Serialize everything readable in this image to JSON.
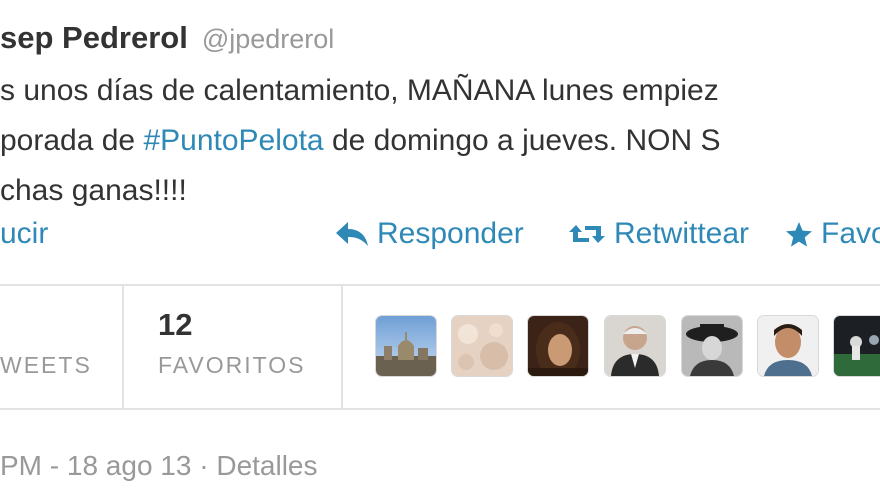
{
  "author": {
    "name": "sep Pedrerol",
    "handle": "@jpedrerol"
  },
  "tweet": {
    "line1": "s unos días de calentamiento,  MAÑANA lunes empiez",
    "line2_pre": "porada de ",
    "hashtag": "#PuntoPelota",
    "line2_post": " de domingo a jueves. NON S",
    "line3": "chas ganas!!!!"
  },
  "actions": {
    "translate_label": "ucir",
    "reply_label": "Responder",
    "retweet_label": "Retwittear",
    "favorite_label": "Favo"
  },
  "stats": {
    "retweets_label": "WEETS",
    "favorites_value": "12",
    "favorites_label": "FAVORITOS"
  },
  "favoriters": [
    {
      "avatar": "cityscape-avatar"
    },
    {
      "avatar": "beige-pattern-avatar"
    },
    {
      "avatar": "woman-portrait-avatar"
    },
    {
      "avatar": "elderly-man-avatar"
    },
    {
      "avatar": "hat-woman-avatar"
    },
    {
      "avatar": "young-man-avatar"
    },
    {
      "avatar": "stadium-avatar"
    }
  ],
  "meta": {
    "timestamp": " PM - 18 ago 13",
    "separator": " · ",
    "details_link": "Detalles"
  },
  "colors": {
    "link": "#2f89b7",
    "text": "#333333",
    "muted": "#999999",
    "divider": "#e3e3e3"
  }
}
